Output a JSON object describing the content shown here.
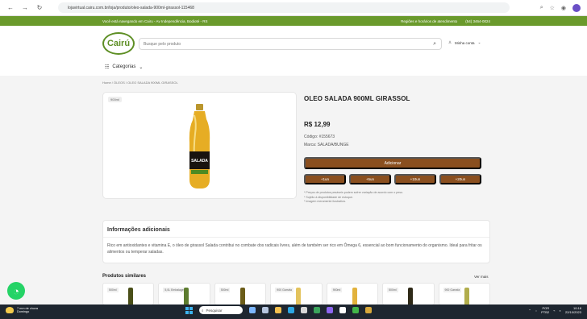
{
  "browser": {
    "url": "lojavirtual.cairu.com.br/loja/produto/oleo-salada-900ml-girassol-115468",
    "back_icon": "arrow-left-icon",
    "forward_icon": "arrow-right-icon",
    "reload_icon": "refresh-icon",
    "extensions": [
      "search-icon",
      "star-icon"
    ]
  },
  "promo": {
    "location": "Você está navegando em Cairu - Av Independência, Bodioté - RS",
    "stores": "Regiões e horários de atendimento",
    "phone": "(54) 3464-0024"
  },
  "header": {
    "logo_text": "Cairú",
    "search_placeholder": "Busque pelo produto",
    "account_label": "Minha conta",
    "categories_label": "Categorias"
  },
  "breadcrumb": "Home / ÓLEOS / OLEO SALADA 900ML GIRASSOL",
  "product": {
    "image_tag": "900ml",
    "bottle_label": "SALADA",
    "title": "OLEO SALADA 900ML GIRASSOL",
    "price": "R$ 12,99",
    "code": "Código: #155673",
    "brand": "Marca: SALADA/BUNGE",
    "add_button": "Adicionar",
    "quantity_buttons": [
      "+1un",
      "+5un",
      "+10un",
      "+20un"
    ],
    "notes": [
      "* Preços de produtos pesáveis podem sofrer variação de acordo com o peso.",
      "* Sujeito à disponibilidade de estoque.",
      "* Imagem meramente ilustrativa."
    ]
  },
  "additional_info": {
    "title": "Informações adicionais",
    "description": "Rico em antioxidantes e vitamina E, o óleo de girassol Salada contribui no combate dos radicais livres, além de também ser rico em Ômega 6, essencial ao bom funcionamento do organismo. Ideal para fritar os alimentos ou temperar saladas."
  },
  "similar": {
    "title": "Produtos similares",
    "see_more": "Ver mais",
    "items": [
      {
        "label": "500ml",
        "color": "#4a4f19"
      },
      {
        "label": "5,0L Embalagem",
        "color": "#5d7c2f"
      },
      {
        "label": "500ml",
        "color": "#6b5c18"
      },
      {
        "label": "900 Garrafa",
        "color": "#e3c35d"
      },
      {
        "label": "900ml",
        "color": "#e2b23c"
      },
      {
        "label": "500ml",
        "color": "#2f2a18"
      },
      {
        "label": "900 Garrafa",
        "color": "#b1ad4c"
      }
    ]
  },
  "taskbar": {
    "weather_1": "7 mm de chuva",
    "weather_2": "Domingo",
    "search": "Pesquisar",
    "lang": "POR",
    "layout": "PTB2",
    "time": "10:18",
    "date": "22/10/2023"
  },
  "colors": {
    "green": "#6a9a2c",
    "brown": "#8a4f1f",
    "whatsapp": "#25d366"
  }
}
